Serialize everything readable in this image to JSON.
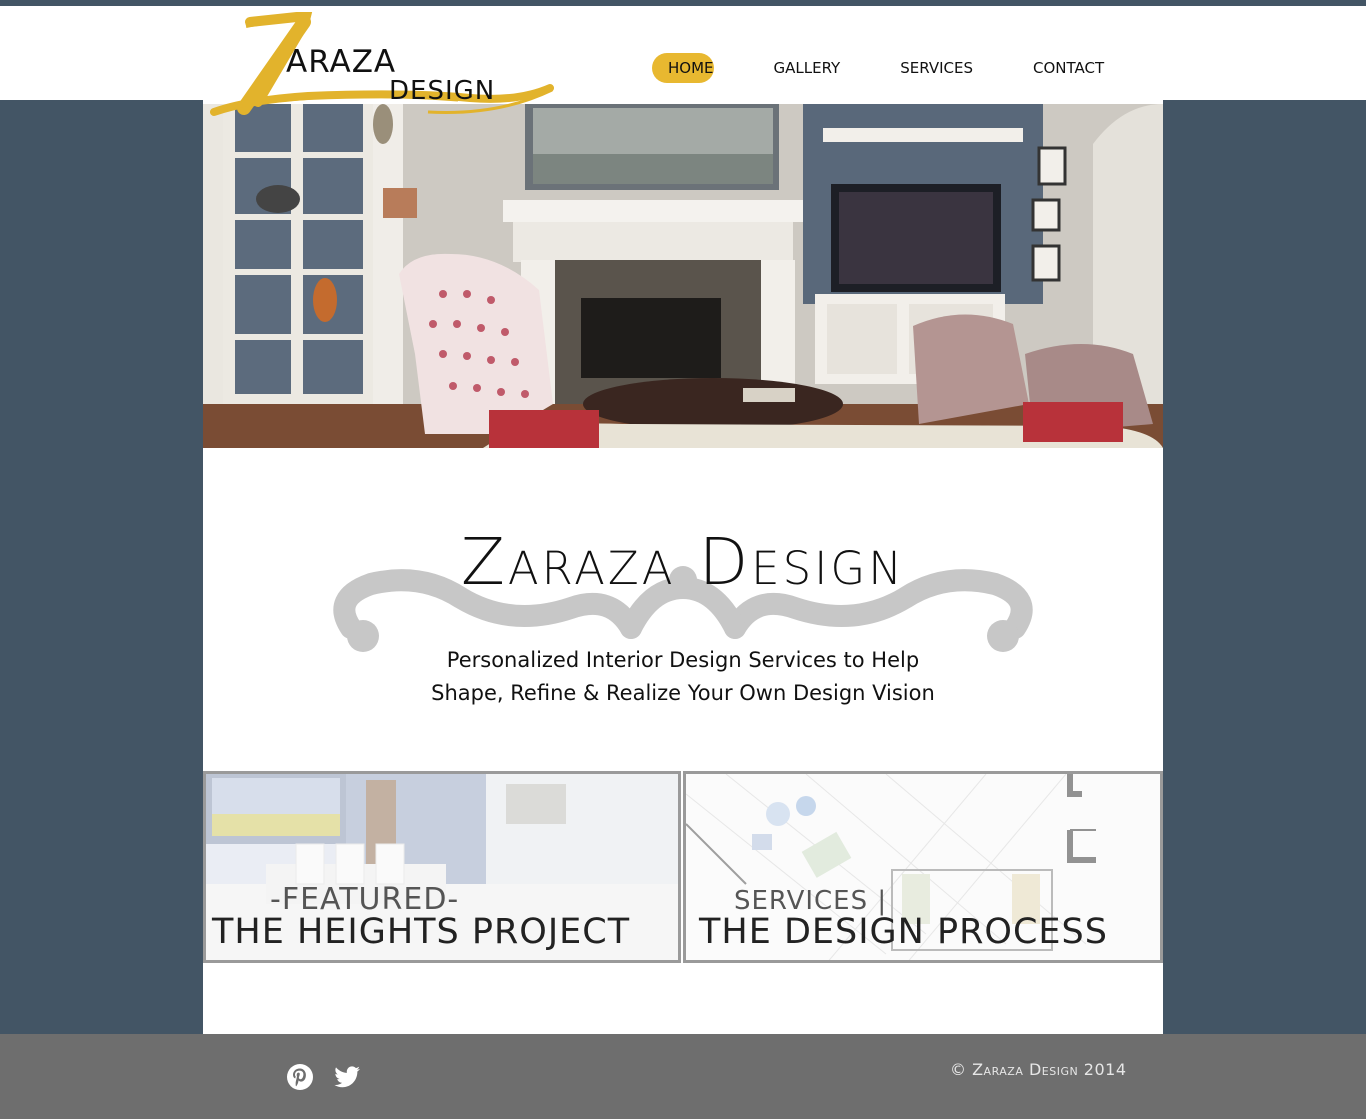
{
  "colors": {
    "page_background": "#435565",
    "accent_gold": "#e8b830",
    "footer_background": "#6e6e6e"
  },
  "logo": {
    "line1": "ARAZA",
    "line2": "DESIGN",
    "initial": "Z"
  },
  "nav": {
    "items": [
      {
        "label": "HOME",
        "active": true
      },
      {
        "label": "GALLERY",
        "active": false
      },
      {
        "label": "SERVICES",
        "active": false
      },
      {
        "label": "CONTACT",
        "active": false
      }
    ]
  },
  "hero": {
    "image": "living-room-photo"
  },
  "intro": {
    "title": "Zaraza Design",
    "tagline_line1": "Personalized Interior Design Services to Help",
    "tagline_line2": "Shape, Refine & Realize Your Own Design Vision"
  },
  "tiles": [
    {
      "kicker": "-FEATURED-",
      "heading": "THE HEIGHTS PROJECT",
      "image": "dining-room-photo"
    },
    {
      "kicker": "SERVICES |",
      "heading": "THE DESIGN PROCESS",
      "image": "design-sketch"
    }
  ],
  "footer": {
    "social": [
      "pinterest-icon",
      "twitter-icon"
    ],
    "copyright": "© Zaraza Design 2014"
  }
}
